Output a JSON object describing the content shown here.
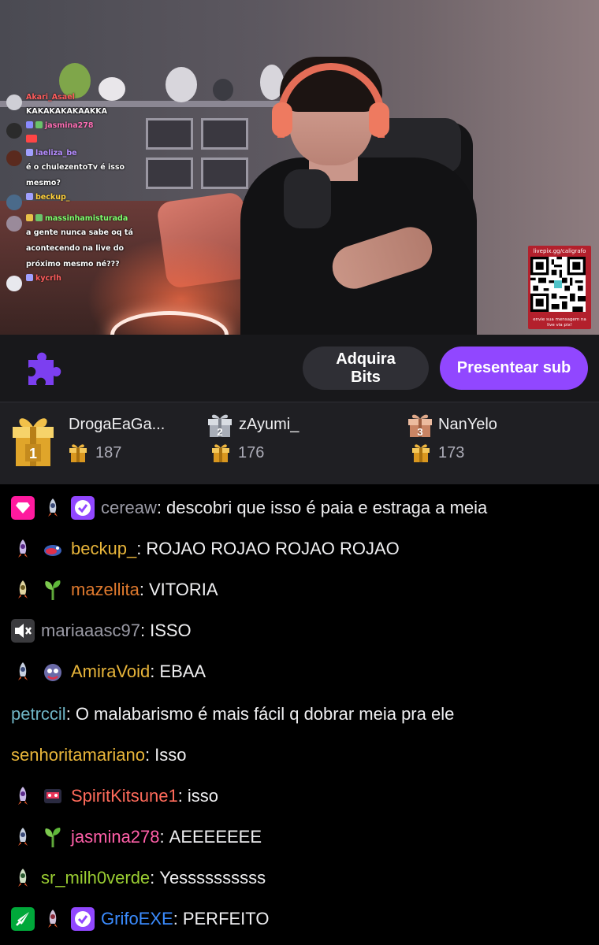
{
  "overlay_chat": [
    {
      "user": "Akari_Asael",
      "text": "KAKAKAKAKAAKKA",
      "color": "#ff5d5d"
    },
    {
      "user": "jasmina278",
      "text": "",
      "color": "#ff6fb5"
    },
    {
      "user": "laeliza_be",
      "text": "é o chulezentoTv é isso mesmo?",
      "color": "#b58cff"
    },
    {
      "user": "beckup_",
      "text": "",
      "color": "#ffd13b"
    },
    {
      "user": "massinhamisturada",
      "text": "a gente nunca sabe oq tá acontecendo na live do próximo mesmo né???",
      "color": "#7dff6d"
    },
    {
      "user": "kycrlh",
      "text": "",
      "color": "#ff5d5d"
    }
  ],
  "qr": {
    "top": "livepix.gg/caligrafo",
    "bottom": "envie sua mensagem na live via pix!"
  },
  "actions": {
    "bits_label": "Adquira Bits",
    "gift_label": "Presentear sub"
  },
  "leaderboard": [
    {
      "rank": "1",
      "name": "DrogaEaGa...",
      "count": "187"
    },
    {
      "rank": "2",
      "name": "zAyumi_",
      "count": "176"
    },
    {
      "rank": "3",
      "name": "NanYelo",
      "count": "173"
    }
  ],
  "chat": [
    {
      "user": "cereaw",
      "text": "descobri que isso é paia e estraga a meia",
      "color": "#9a9aa5"
    },
    {
      "user": "beckup_",
      "text": "ROJAO ROJAO ROJAO ROJAO",
      "color": "#e8b53a"
    },
    {
      "user": "mazellita",
      "text": "VITORIA",
      "color": "#e07a2e"
    },
    {
      "user": "mariaaasc97",
      "text": "ISSO",
      "color": "#9a9aa5"
    },
    {
      "user": "AmiraVoid",
      "text": "EBAA",
      "color": "#e8b53a"
    },
    {
      "user": "petrccil",
      "text": "O malabarismo é mais fácil q dobrar meia pra ele",
      "color": "#6fb5c5"
    },
    {
      "user": "senhoritamariano",
      "text": "Isso",
      "color": "#e8b53a"
    },
    {
      "user": "SpiritKitsune1",
      "text": "isso",
      "color": "#ff6b5b"
    },
    {
      "user": "jasmina278",
      "text": "AEEEEEEE",
      "color": "#ff5fa8"
    },
    {
      "user": "sr_milh0verde",
      "text": "Yessssssssss",
      "color": "#9acd32"
    },
    {
      "user": "GrifoEXE",
      "text": "PERFEITO",
      "color": "#3b8cff"
    }
  ]
}
